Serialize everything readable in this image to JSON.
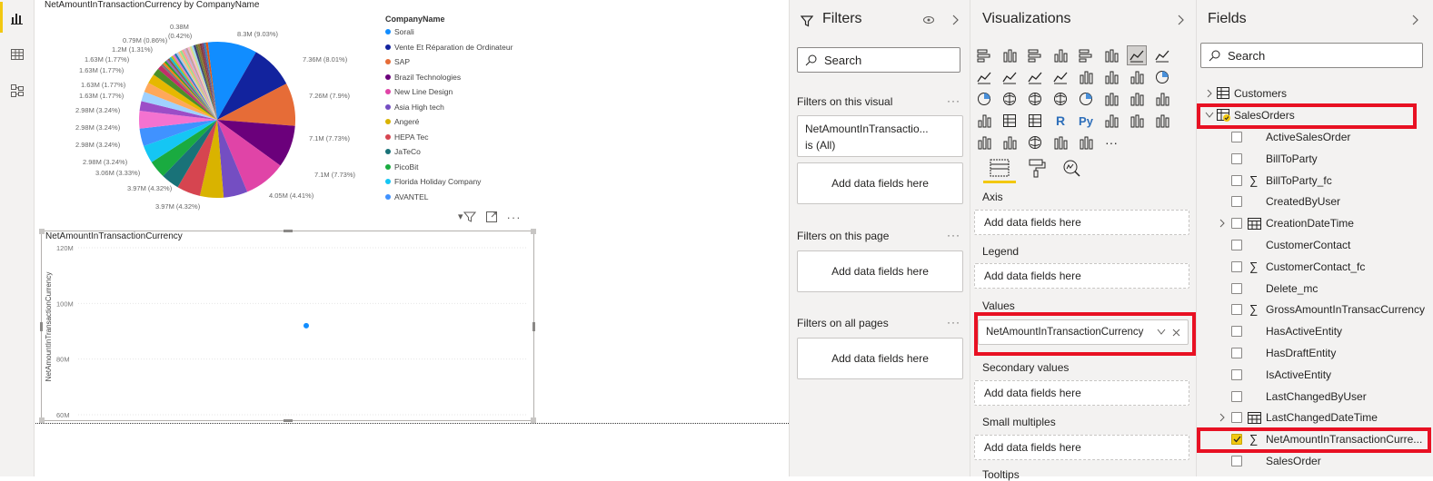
{
  "left_nav": {
    "items": [
      "report-view",
      "data-view",
      "model-view"
    ],
    "accent": "#f2c811"
  },
  "pie_chart": {
    "title": "NetAmountInTransactionCurrency by CompanyName",
    "legend_title": "CompanyName",
    "slice_labels": [
      "8.3M (9.03%)",
      "7.36M (8.01%)",
      "7.26M (7.9%)",
      "7.1M (7.73%)",
      "7.1M (7.73%)",
      "4.05M (4.41%)",
      "3.97M (4.32%)",
      "3.97M (4.32%)",
      "3.06M (3.33%)",
      "2.98M (3.24%)",
      "2.98M (3.24%)",
      "2.98M (3.24%)",
      "2.98M (3.24%)",
      "1.63M (1.77%)",
      "1.63M (1.77%)",
      "1.63M (1.77%)",
      "1.63M (1.77%)",
      "1.2M (1.31%)",
      "0.79M (0.86%)",
      "0.38M",
      "(0.42%)"
    ]
  },
  "scatter_chart": {
    "title": "NetAmountInTransactionCurrency",
    "y_axis_label": "NetAmountInTransactionCurrency",
    "y_ticks": [
      "120M",
      "100M",
      "80M",
      "60M"
    ]
  },
  "chart_data": [
    {
      "type": "pie",
      "title": "NetAmountInTransactionCurrency by CompanyName",
      "legend": "right",
      "categories": [
        "Sorali",
        "Vente Et Réparation de Ordinateur",
        "SAP",
        "Brazil Technologies",
        "New Line Design",
        "Asia High tech",
        "Angeré",
        "HEPA Tec",
        "JaTeCo",
        "PicoBit",
        "Florida Holiday Company",
        "AVANTEL"
      ],
      "values": [
        8.3,
        7.36,
        7.26,
        7.1,
        7.1,
        4.05,
        3.97,
        3.97,
        3.06,
        2.98,
        2.98,
        2.98,
        2.98,
        1.63,
        1.63,
        1.63,
        1.63,
        1.2,
        0.79,
        0.38
      ],
      "colors": [
        "#118dff",
        "#12239e",
        "#e66c37",
        "#6b007b",
        "#e044a7",
        "#744ec2",
        "#d9b300",
        "#d64550",
        "#197278",
        "#1aab40",
        "#15c6f4",
        "#4092ff",
        "#f472d0",
        "#9c4dc7",
        "#a0d1ff",
        "#ffa85a",
        "#e6b800",
        "#4b8f29",
        "#c02f6b",
        "#7a7a7a"
      ]
    },
    {
      "type": "scatter",
      "title": "NetAmountInTransactionCurrency",
      "ylabel": "NetAmountInTransactionCurrency",
      "ylim": [
        60,
        120
      ],
      "y_unit": "M",
      "points": [
        {
          "y": 92
        }
      ]
    }
  ],
  "legend_items": [
    {
      "label": "Sorali",
      "color": "#118dff"
    },
    {
      "label": "Vente Et Réparation de Ordinateur",
      "color": "#12239e"
    },
    {
      "label": "SAP",
      "color": "#e66c37"
    },
    {
      "label": "Brazil Technologies",
      "color": "#6b007b"
    },
    {
      "label": "New Line Design",
      "color": "#e044a7"
    },
    {
      "label": "Asia High tech",
      "color": "#744ec2"
    },
    {
      "label": "Angeré",
      "color": "#d9b300"
    },
    {
      "label": "HEPA Tec",
      "color": "#d64550"
    },
    {
      "label": "JaTeCo",
      "color": "#197278"
    },
    {
      "label": "PicoBit",
      "color": "#1aab40"
    },
    {
      "label": "Florida Holiday Company",
      "color": "#15c6f4"
    },
    {
      "label": "AVANTEL",
      "color": "#4092ff"
    }
  ],
  "filters": {
    "title": "Filters",
    "search_placeholder": "Search",
    "on_visual_label": "Filters on this visual",
    "visual_filter_field": "NetAmountInTransactio...",
    "visual_filter_value": "is (All)",
    "add_fields": "Add data fields here",
    "on_page_label": "Filters on this page",
    "all_pages_label": "Filters on all pages"
  },
  "visualizations": {
    "title": "Visualizations",
    "wells": {
      "axis": "Axis",
      "legend": "Legend",
      "values": "Values",
      "secondary": "Secondary values",
      "small_multiples": "Small multiples",
      "tooltips": "Tooltips"
    },
    "add_fields": "Add data fields here",
    "values_field": "NetAmountInTransactionCurrency",
    "icon_r": "R",
    "icon_py": "Py",
    "icon_more": "···"
  },
  "fields": {
    "title": "Fields",
    "search_placeholder": "Search",
    "tables": [
      {
        "name": "Customers",
        "expanded": false
      },
      {
        "name": "SalesOrders",
        "expanded": true
      }
    ],
    "items": [
      {
        "label": "ActiveSalesOrder",
        "sigma": false,
        "expandable": false,
        "calendar": false,
        "checked": false
      },
      {
        "label": "BillToParty",
        "sigma": false,
        "expandable": false,
        "calendar": false,
        "checked": false
      },
      {
        "label": "BillToParty_fc",
        "sigma": true,
        "expandable": false,
        "calendar": false,
        "checked": false
      },
      {
        "label": "CreatedByUser",
        "sigma": false,
        "expandable": false,
        "calendar": false,
        "checked": false
      },
      {
        "label": "CreationDateTime",
        "sigma": false,
        "expandable": true,
        "calendar": true,
        "checked": false
      },
      {
        "label": "CustomerContact",
        "sigma": false,
        "expandable": false,
        "calendar": false,
        "checked": false
      },
      {
        "label": "CustomerContact_fc",
        "sigma": true,
        "expandable": false,
        "calendar": false,
        "checked": false
      },
      {
        "label": "Delete_mc",
        "sigma": false,
        "expandable": false,
        "calendar": false,
        "checked": false
      },
      {
        "label": "GrossAmountInTransacCurrency",
        "sigma": true,
        "expandable": false,
        "calendar": false,
        "checked": false
      },
      {
        "label": "HasActiveEntity",
        "sigma": false,
        "expandable": false,
        "calendar": false,
        "checked": false
      },
      {
        "label": "HasDraftEntity",
        "sigma": false,
        "expandable": false,
        "calendar": false,
        "checked": false
      },
      {
        "label": "IsActiveEntity",
        "sigma": false,
        "expandable": false,
        "calendar": false,
        "checked": false
      },
      {
        "label": "LastChangedByUser",
        "sigma": false,
        "expandable": false,
        "calendar": false,
        "checked": false
      },
      {
        "label": "LastChangedDateTime",
        "sigma": false,
        "expandable": true,
        "calendar": true,
        "checked": false
      },
      {
        "label": "NetAmountInTransactionCurre...",
        "sigma": true,
        "expandable": false,
        "calendar": false,
        "checked": true
      },
      {
        "label": "SalesOrder",
        "sigma": false,
        "expandable": false,
        "calendar": false,
        "checked": false
      }
    ]
  },
  "highlight_color": "#e81123"
}
